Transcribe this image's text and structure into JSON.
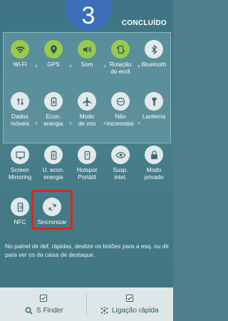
{
  "header": {
    "step": "3",
    "done_label": "CONCLUÍDO"
  },
  "active_tiles": [
    {
      "label": "Wi-Fi",
      "label2": "",
      "icon": "wifi-icon",
      "state": "active"
    },
    {
      "label": "GPS",
      "label2": "",
      "icon": "location-icon",
      "state": "active"
    },
    {
      "label": "Som",
      "label2": "",
      "icon": "volume-icon",
      "state": "active"
    },
    {
      "label": "Rotação",
      "label2": "do ecrã",
      "icon": "rotation-icon",
      "state": "active"
    },
    {
      "label": "Bluetooth",
      "label2": "",
      "icon": "bluetooth-icon",
      "state": "inactive"
    },
    {
      "label": "Dados",
      "label2": "móveis",
      "icon": "mobile-data-icon",
      "state": "inactive"
    },
    {
      "label": "Econ.",
      "label2": "energia",
      "icon": "battery-saver-icon",
      "state": "inactive"
    },
    {
      "label": "Modo",
      "label2": "de voo",
      "icon": "airplane-icon",
      "state": "inactive"
    },
    {
      "label": "Não",
      "label2": "incomodar",
      "icon": "do-not-disturb-icon",
      "state": "inactive"
    },
    {
      "label": "Lanterna",
      "label2": "",
      "icon": "flashlight-icon",
      "state": "inactive"
    }
  ],
  "more_tiles": [
    {
      "label": "Screen",
      "label2": "Mirroring",
      "icon": "screen-mirroring-icon"
    },
    {
      "label": "U. econ.",
      "label2": "energia",
      "icon": "ultra-power-saving-icon"
    },
    {
      "label": "Hotspot",
      "label2": "Portátil",
      "icon": "hotspot-icon"
    },
    {
      "label": "Susp.",
      "label2": "intel.",
      "icon": "smart-stay-icon"
    },
    {
      "label": "Modo",
      "label2": "privado",
      "icon": "private-mode-icon"
    },
    {
      "label": "NFC",
      "label2": "",
      "icon": "nfc-icon"
    },
    {
      "label": "Sincronizar",
      "label2": "",
      "icon": "sync-icon"
    }
  ],
  "info_text": "No painel de def. rápidas, deslize os botões para a esq. ou dir. para ver os da caixa de destaque.",
  "bottom_bar": {
    "left": {
      "label": "S Finder",
      "icon": "search-icon",
      "checked": true
    },
    "right": {
      "label": "Ligação rápida",
      "icon": "quick-connect-icon",
      "checked": true
    }
  },
  "colors": {
    "active": "#9bc94e",
    "inactive": "#e2e9ea",
    "highlight": "#e2231a",
    "badge": "#3d6fb8"
  }
}
